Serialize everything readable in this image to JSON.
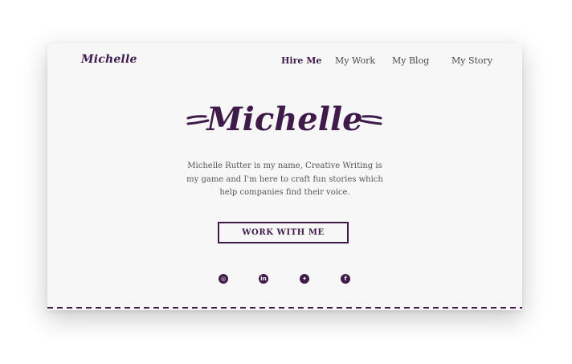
{
  "brand": {
    "logo_text": "Michelle"
  },
  "nav": {
    "items": [
      {
        "label": "Hire Me",
        "active": true
      },
      {
        "label": "My Work",
        "active": false
      },
      {
        "label": "My Blog",
        "active": false
      },
      {
        "label": "My Story",
        "active": false
      }
    ]
  },
  "hero": {
    "title": "Michelle",
    "description": "Michelle Rutter is my name, Creative Writing is my game and I'm here to craft fun stories which help companies find their voice.",
    "cta_label": "WORK WITH ME"
  },
  "social": {
    "icons": [
      {
        "name": "instagram-icon",
        "glyph": "◎"
      },
      {
        "name": "linkedin-icon",
        "glyph": "in"
      },
      {
        "name": "twitter-icon",
        "glyph": "✦"
      },
      {
        "name": "facebook-icon",
        "glyph": "f"
      }
    ]
  },
  "colors": {
    "brand": "#3f1b4a",
    "text": "#555555",
    "background": "#f7f7f7"
  }
}
